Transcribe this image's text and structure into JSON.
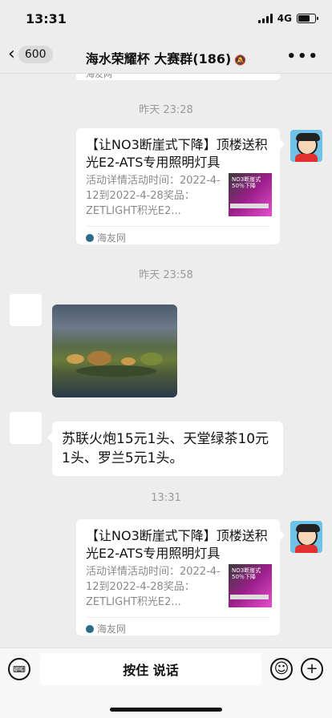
{
  "status_bar": {
    "time": "13:31",
    "network": "4G"
  },
  "nav": {
    "back_count": "600",
    "title": "海水荣耀杯 大赛群(186)"
  },
  "partial_card_source": "海友网",
  "messages": [
    {
      "type": "timestamp",
      "text": "昨天 23:28"
    },
    {
      "type": "link",
      "side": "right",
      "title": "【让NO3断崖式下降】顶楼送积光E2-ATS专用照明灯具",
      "desc": "活动详情活动时间：2022-4-12到2022-4-28奖品：ZETLIGHT积光E2...",
      "thumb_text": "NO3断崖式 50％下降",
      "source": "海友网"
    },
    {
      "type": "timestamp",
      "text": "昨天 23:58"
    },
    {
      "type": "image",
      "side": "left"
    },
    {
      "type": "text",
      "side": "left",
      "text": "苏联火炮15元1头、天堂绿茶10元1头、罗兰5元1头。"
    },
    {
      "type": "timestamp",
      "text": "13:31"
    },
    {
      "type": "link",
      "side": "right",
      "title": "【让NO3断崖式下降】顶楼送积光E2-ATS专用照明灯具",
      "desc": "活动详情活动时间：2022-4-12到2022-4-28奖品：ZETLIGHT积光E2...",
      "thumb_text": "NO3断崖式 50％下降",
      "source": "海友网"
    }
  ],
  "input_bar": {
    "hold_to_talk": "按住 说话"
  },
  "icons": [
    "back-chevron-icon",
    "mute-bell-icon",
    "more-icon",
    "voice-keyboard-icon",
    "emoji-icon",
    "plus-icon"
  ],
  "colors": {
    "background": "#ededed",
    "bubble": "#ffffff",
    "muted_text": "#9a9a9a"
  }
}
